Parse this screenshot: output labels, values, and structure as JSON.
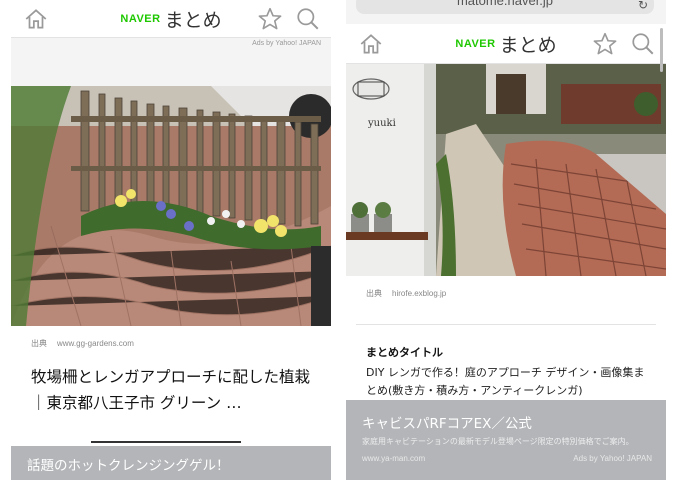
{
  "left": {
    "header": {
      "brand": "NAVER",
      "title": "まとめ"
    },
    "ads_label": "Ads by Yahoo! JAPAN",
    "source": {
      "label": "出典",
      "url": "www.gg-gardens.com"
    },
    "caption": "牧場柵とレンガアプローチに配した植栽｜東京都八王子市 グリーン …",
    "banner": {
      "title": "話題のホットクレンジングゲル！"
    }
  },
  "right": {
    "url_bar": "matome.naver.jp",
    "header": {
      "brand": "NAVER",
      "title": "まとめ"
    },
    "photo_text": "yuuki",
    "source": {
      "label": "出典",
      "url": "hirofe.exblog.jp"
    },
    "section_title": "まとめタイトル",
    "section_desc": "DIY レンガで作る！庭のアプローチ デザイン・画像集まとめ(敷き方・積み方・アンティークレンガ)",
    "banner": {
      "title": "キャビスパRFコアEX／公式",
      "desc": "家庭用キャビテーションの最新モデル登場ページ限定の特別価格でご案内。",
      "url": "www.ya-man.com",
      "ads": "Ads by Yahoo! JAPAN"
    }
  },
  "icons": [
    "home-icon",
    "star-icon",
    "search-icon",
    "reload-icon"
  ],
  "colors": {
    "naver_green": "#1ec800",
    "banner_grey": "#b3b5b8",
    "icon_grey": "#9a9a9a"
  }
}
